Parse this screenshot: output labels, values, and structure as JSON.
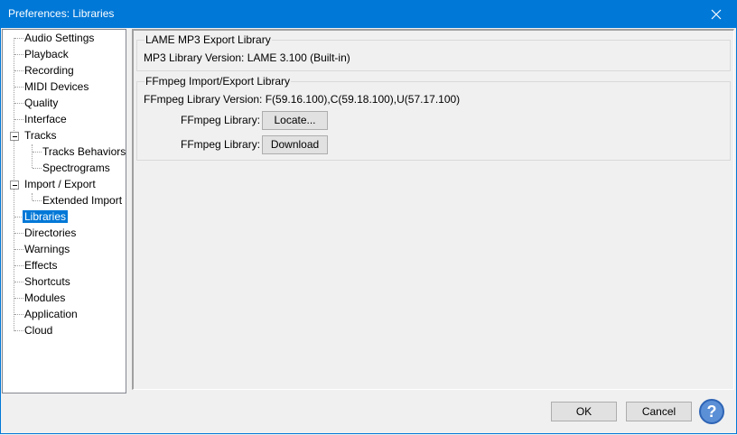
{
  "window": {
    "title": "Preferences: Libraries"
  },
  "tree": {
    "items": [
      {
        "label": "Audio Settings"
      },
      {
        "label": "Playback"
      },
      {
        "label": "Recording"
      },
      {
        "label": "MIDI Devices"
      },
      {
        "label": "Quality"
      },
      {
        "label": "Interface"
      },
      {
        "label": "Tracks"
      },
      {
        "label": "Tracks Behaviors"
      },
      {
        "label": "Spectrograms"
      },
      {
        "label": "Import / Export"
      },
      {
        "label": "Extended Import"
      },
      {
        "label": "Libraries"
      },
      {
        "label": "Directories"
      },
      {
        "label": "Warnings"
      },
      {
        "label": "Effects"
      },
      {
        "label": "Shortcuts"
      },
      {
        "label": "Modules"
      },
      {
        "label": "Application"
      },
      {
        "label": "Cloud"
      }
    ],
    "selected": "Libraries"
  },
  "lame": {
    "legend": "LAME MP3 Export Library",
    "version_text": "MP3 Library Version: LAME 3.100 (Built-in)"
  },
  "ffmpeg": {
    "legend": "FFmpeg Import/Export Library",
    "version_text": "FFmpeg Library Version: F(59.16.100),C(59.18.100),U(57.17.100)",
    "locate_label": "FFmpeg Library:",
    "locate_button": "Locate...",
    "download_label": "FFmpeg Library:",
    "download_button": "Download"
  },
  "footer": {
    "ok": "OK",
    "cancel": "Cancel",
    "help": "?"
  }
}
